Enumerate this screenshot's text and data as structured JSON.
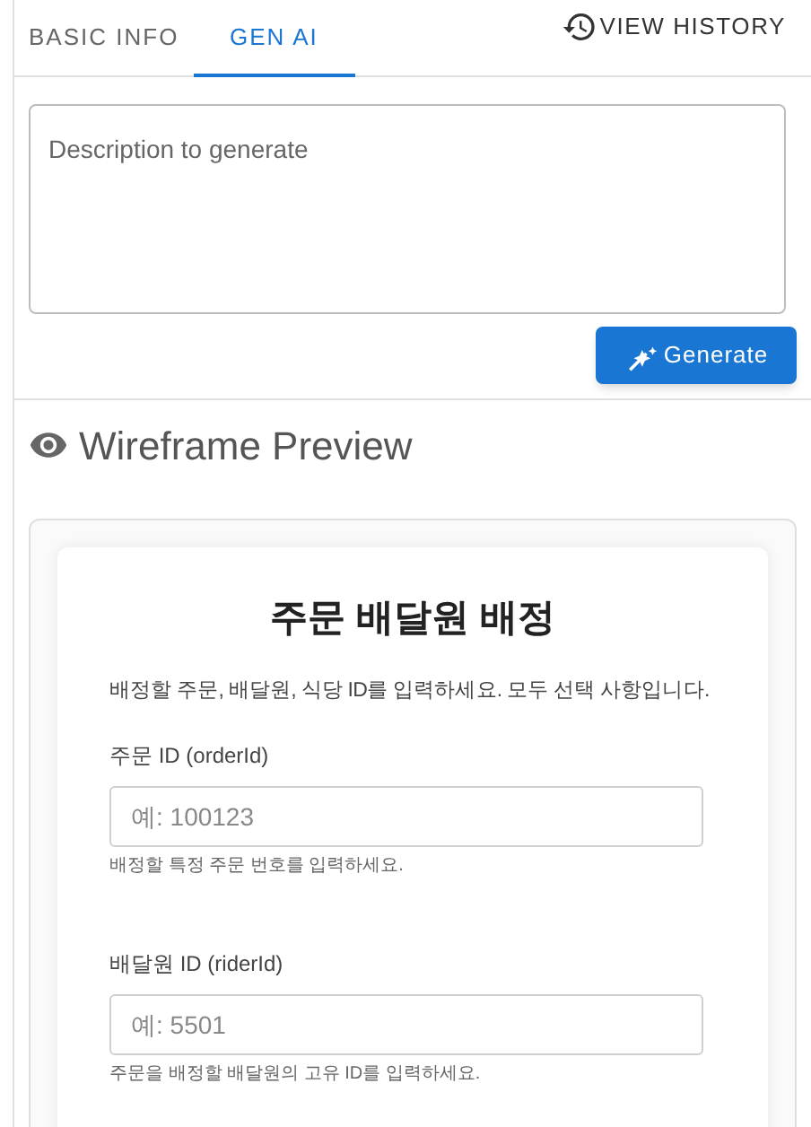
{
  "tabs": [
    {
      "label": "BASIC INFO",
      "selected": false
    },
    {
      "label": "GEN AI",
      "selected": true
    }
  ],
  "history_button": {
    "label": "VIEW HISTORY"
  },
  "description_field": {
    "placeholder": "Description to generate"
  },
  "generate_button": {
    "label": "Generate"
  },
  "preview": {
    "title": "Wireframe Preview",
    "form": {
      "title": "주문 배달원 배정",
      "description": "배정할 주문, 배달원, 식당 ID를 입력하세요. 모두 선택 사항입니다.",
      "fields": [
        {
          "label": "주문 ID (orderId)",
          "placeholder": "예: 100123",
          "helper": "배정할 특정 주문 번호를 입력하세요."
        },
        {
          "label": "배달원 ID (riderId)",
          "placeholder": "예: 5501",
          "helper": "주문을 배정할 배달원의 고유 ID를 입력하세요."
        }
      ]
    }
  }
}
